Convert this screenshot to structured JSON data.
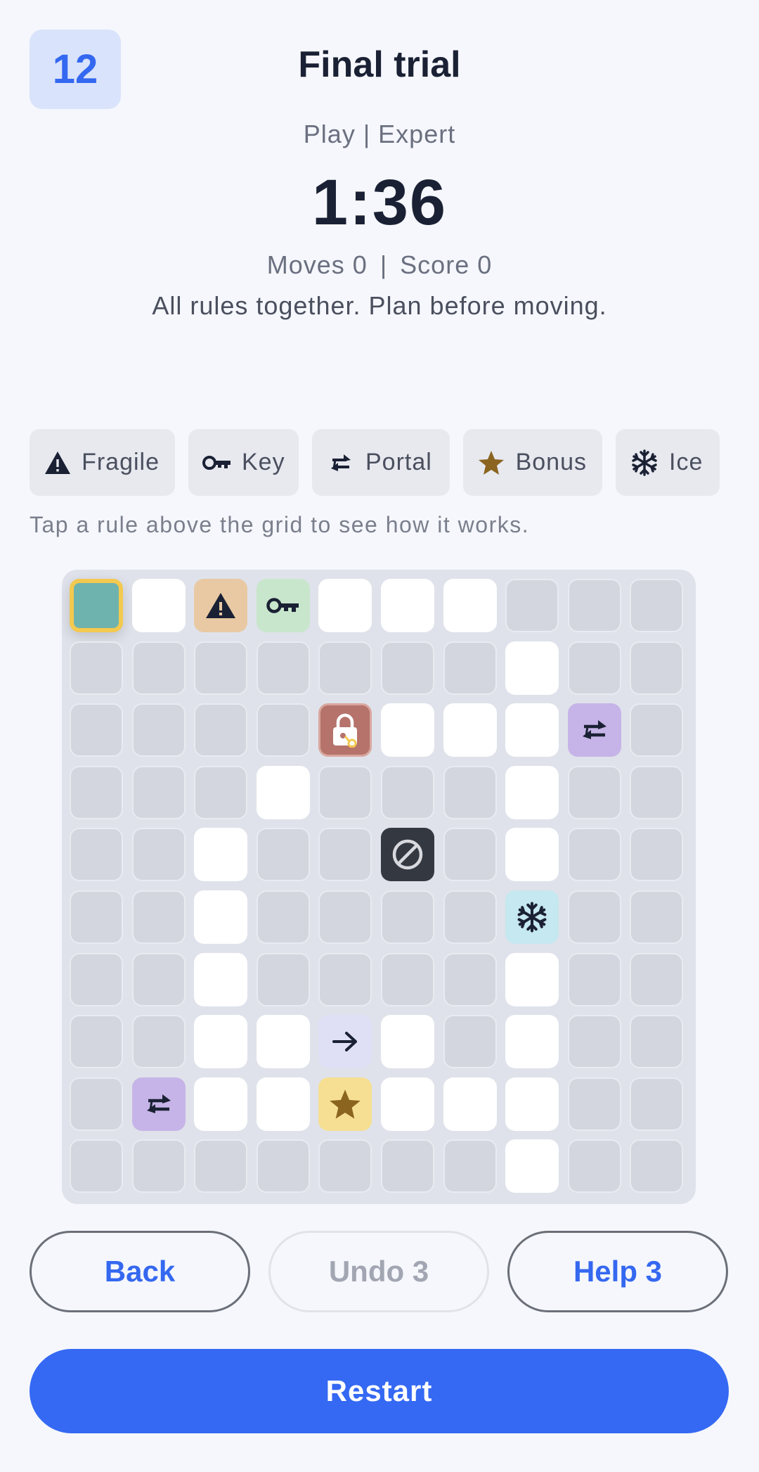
{
  "header": {
    "level": "12",
    "title": "Final trial",
    "subtitle": "Play | Expert",
    "timer": "1:36",
    "moves": "Moves 0",
    "stats_separator": "|",
    "score": "Score 0",
    "description": "All rules together. Plan before moving."
  },
  "rules": [
    {
      "label": "Fragile",
      "icon": "warning-icon"
    },
    {
      "label": "Key",
      "icon": "key-icon"
    },
    {
      "label": "Portal",
      "icon": "portal-icon"
    },
    {
      "label": "Bonus",
      "icon": "star-icon"
    },
    {
      "label": "Ice",
      "icon": "snowflake-icon"
    }
  ],
  "hint": "Tap a rule above the grid to see how it works.",
  "grid": {
    "rows": 10,
    "cols": 10,
    "legend": {
      "#": "blocked",
      ".": "open",
      "P": "player",
      "F": "fragile",
      "K": "key",
      "L": "lock",
      "T": "portal",
      "W": "wall",
      "I": "ice",
      "A": "arrow-right",
      "B": "bonus"
    },
    "layout": [
      "P.FK...###",
      "#######.##",
      "####L...T#",
      "###.###.##",
      "##.##W#.##",
      "##.####I##",
      "##.####.##",
      "##..A.#.##",
      "#T..B...##",
      "#######.##"
    ]
  },
  "buttons": {
    "back": "Back",
    "undo": "Undo 3",
    "help": "Help 3",
    "restart": "Restart"
  },
  "colors": {
    "accent": "#3569f3",
    "player": "#6fb3ae",
    "player_border": "#f3c94f",
    "fragile": "#e8c9a3",
    "key": "#c8e6cc",
    "lock": "#b5736b",
    "portal": "#c6b4e8",
    "wall": "#343840",
    "ice": "#c6e8f0",
    "bonus": "#f6df93"
  }
}
